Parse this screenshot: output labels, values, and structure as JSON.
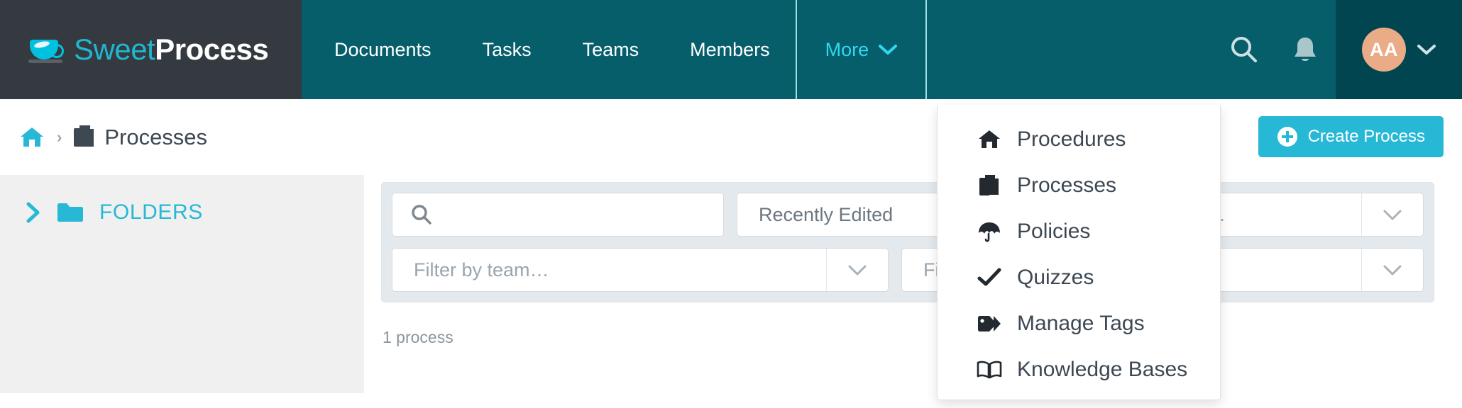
{
  "brand": {
    "name_light": "Sweet",
    "name_bold": "Process",
    "logo_icon": "coffee-cup-icon",
    "accent_cyan": "#27b8d6",
    "logo_teal": "#21b6cf",
    "nav_teal": "#065e6b",
    "logo_block_dark": "#343a40",
    "avatar_peach": "#eaac86"
  },
  "navbar": {
    "items": [
      {
        "label": "Documents",
        "active": false
      },
      {
        "label": "Tasks",
        "active": false
      },
      {
        "label": "Teams",
        "active": false
      },
      {
        "label": "Members",
        "active": false
      }
    ],
    "more": {
      "label": "More",
      "caret": "⌄",
      "active": true
    },
    "search_icon": "search-icon",
    "bell_icon": "bell-icon",
    "avatar_initials": "AA",
    "avatar_caret": "⌄"
  },
  "more_menu": {
    "items": [
      {
        "label": "Procedures",
        "icon": "home-icon"
      },
      {
        "label": "Processes",
        "icon": "copy-documents-icon"
      },
      {
        "label": "Policies",
        "icon": "umbrella-icon"
      },
      {
        "label": "Quizzes",
        "icon": "check-icon"
      },
      {
        "label": "Manage Tags",
        "icon": "tag-icon"
      },
      {
        "label": "Knowledge Bases",
        "icon": "open-book-icon"
      }
    ]
  },
  "breadcrumb": {
    "home_icon": "home-icon",
    "separator": "›",
    "current_icon": "copy-documents-icon",
    "current_label": "Processes"
  },
  "actions": {
    "create_label": "Create Process",
    "create_icon": "plus-circle-icon"
  },
  "sidebar": {
    "chevron_icon": "chevron-right-icon",
    "folder_icon": "folder-icon",
    "folders_label": "FOLDERS"
  },
  "filters": {
    "search": {
      "placeholder": "",
      "value": "",
      "icon": "search-icon"
    },
    "sort": {
      "value": "Recently Edited",
      "caret": "⌄"
    },
    "tag": {
      "placeholder": "Filter by tag…",
      "caret": "⌄"
    },
    "team": {
      "placeholder": "Filter by team…",
      "caret": "⌄"
    },
    "status": {
      "placeholder": "Filter by status…",
      "caret": "⌄"
    }
  },
  "results": {
    "count_text": "1 process"
  }
}
